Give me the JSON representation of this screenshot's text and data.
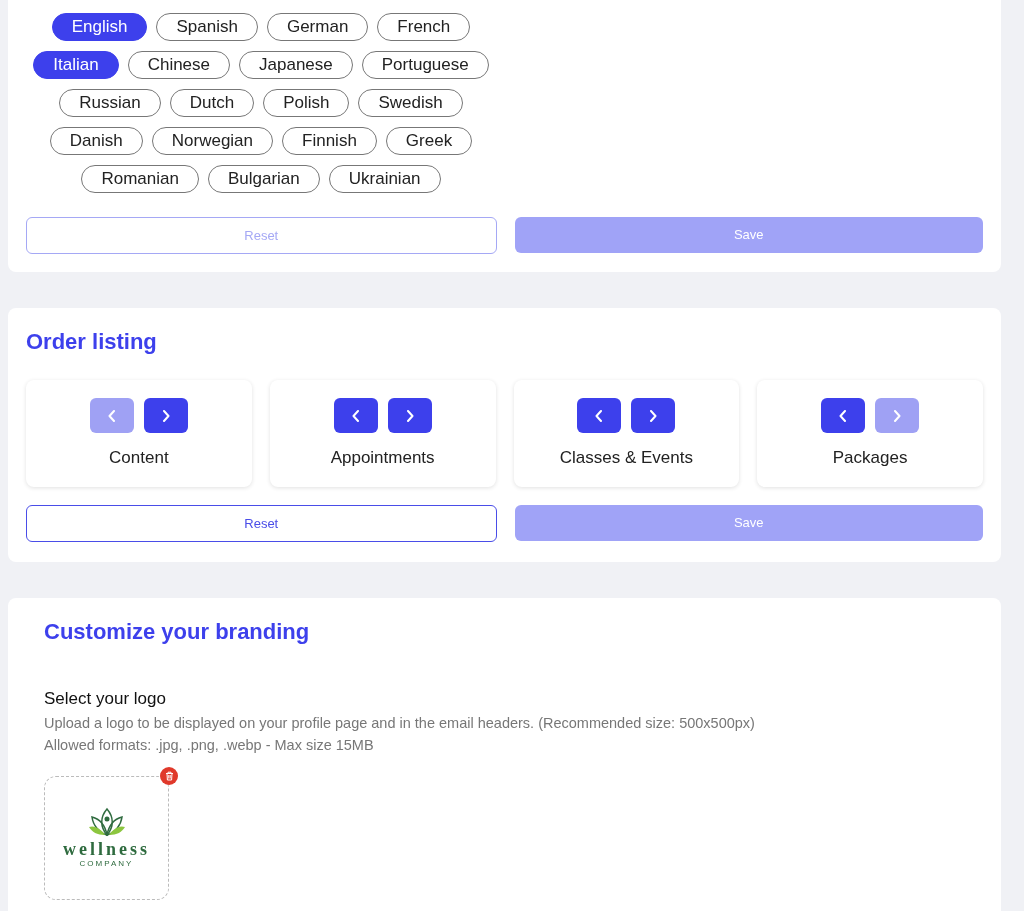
{
  "languages": {
    "rows": [
      {
        "items": [
          {
            "label": "English",
            "selected": true
          },
          {
            "label": "Spanish",
            "selected": false
          },
          {
            "label": "German",
            "selected": false
          },
          {
            "label": "French",
            "selected": false
          }
        ]
      },
      {
        "items": [
          {
            "label": "Italian",
            "selected": true
          },
          {
            "label": "Chinese",
            "selected": false
          },
          {
            "label": "Japanese",
            "selected": false
          },
          {
            "label": "Portuguese",
            "selected": false
          }
        ]
      },
      {
        "items": [
          {
            "label": "Russian",
            "selected": false
          },
          {
            "label": "Dutch",
            "selected": false
          },
          {
            "label": "Polish",
            "selected": false
          },
          {
            "label": "Swedish",
            "selected": false
          }
        ]
      },
      {
        "items": [
          {
            "label": "Danish",
            "selected": false
          },
          {
            "label": "Norwegian",
            "selected": false
          },
          {
            "label": "Finnish",
            "selected": false
          },
          {
            "label": "Greek",
            "selected": false
          }
        ]
      },
      {
        "items": [
          {
            "label": "Romanian",
            "selected": false
          },
          {
            "label": "Bulgarian",
            "selected": false
          },
          {
            "label": "Ukrainian",
            "selected": false
          }
        ]
      }
    ],
    "reset": {
      "label": "Reset",
      "disabled": true
    },
    "save": {
      "label": "Save",
      "disabled": true
    }
  },
  "order_listing": {
    "title": "Order listing",
    "items": [
      {
        "label": "Content",
        "prev_disabled": true,
        "next_disabled": false
      },
      {
        "label": "Appointments",
        "prev_disabled": false,
        "next_disabled": false
      },
      {
        "label": "Classes & Events",
        "prev_disabled": false,
        "next_disabled": false
      },
      {
        "label": "Packages",
        "prev_disabled": false,
        "next_disabled": true
      }
    ],
    "reset": {
      "label": "Reset",
      "disabled": false
    },
    "save": {
      "label": "Save",
      "disabled": true
    }
  },
  "branding": {
    "title": "Customize your branding",
    "logo_heading": "Select your logo",
    "description": [
      "Upload a logo to be displayed on your profile page and in the email headers. (Recommended size: 500x500px)",
      "Allowed formats: .jpg, .png, .webp - Max size 15MB"
    ],
    "logo": {
      "name": "wellness",
      "tagline": "COMPANY"
    }
  }
}
